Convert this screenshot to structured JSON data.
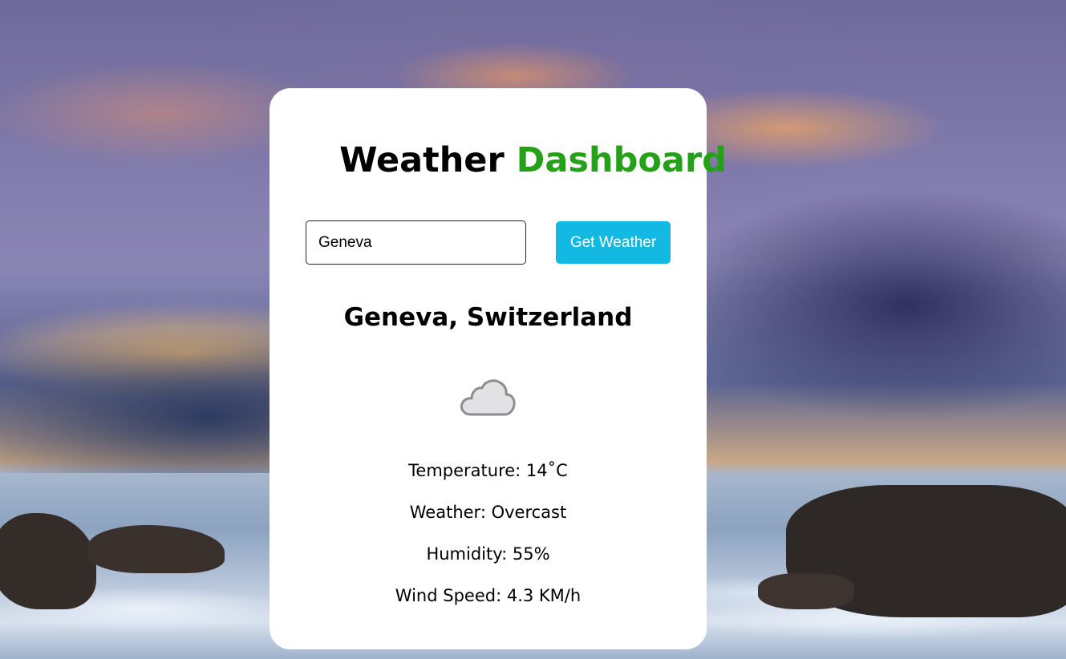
{
  "header": {
    "title_part1": "Weather",
    "title_part2": "Dashboard",
    "accent_color": "#24a019"
  },
  "search": {
    "value": "Geneva",
    "button_label": "Get Weather",
    "button_color": "#14b9e3"
  },
  "result": {
    "location": "Geneva, Switzerland",
    "icon": "cloud-icon",
    "temperature": "Temperature: 14˚C",
    "weather": "Weather: Overcast",
    "humidity": "Humidity: 55%",
    "wind": "Wind Speed: 4.3 KM/h"
  }
}
